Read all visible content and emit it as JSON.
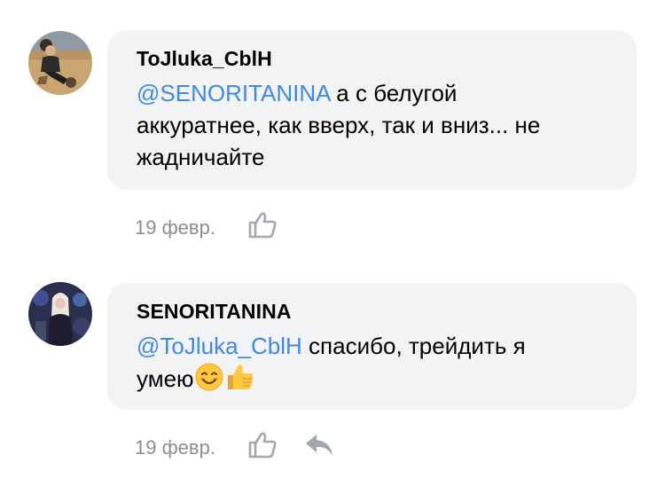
{
  "comments": [
    {
      "author": "ToJluka_CblH",
      "mention": "@SENORITANINA",
      "text_line1": " а с белугой",
      "text_line2": "аккуратнее, как вверх, так и вниз... не",
      "text_line3": "жадничайте",
      "date": "19 февр.",
      "icons": {
        "avatar": "user-photo-avatar",
        "like": "thumbs-up-icon"
      }
    },
    {
      "author": "SENORITANINA",
      "mention": "@ToJluka_CblH",
      "text_line1": " спасибо, трейдить я",
      "text_line2": "умею",
      "emojis": [
        "smiling-face-emoji",
        "thumbs-up-emoji"
      ],
      "date": "19 февр.",
      "icons": {
        "avatar": "user-photo-avatar",
        "like": "thumbs-up-icon",
        "reply": "reply-arrow-icon"
      }
    }
  ],
  "colors": {
    "mention": "#3f8ae0",
    "bubble": "#f2f3f5",
    "meta": "#8a8d91",
    "icon": "#a3a8b0"
  }
}
